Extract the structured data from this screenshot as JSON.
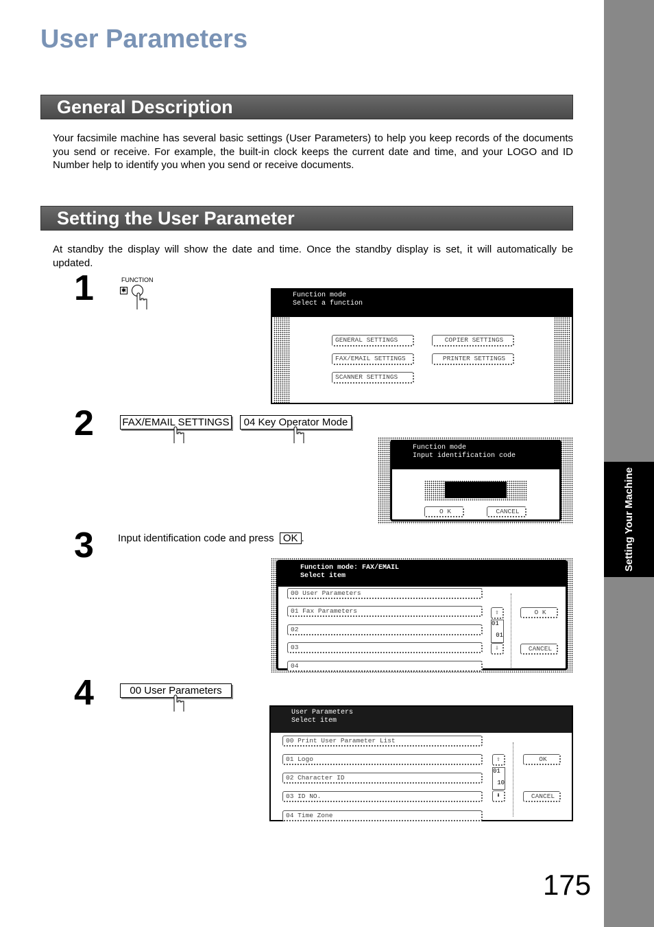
{
  "title": "User Parameters",
  "sections": [
    {
      "heading": "General Description",
      "text": "Your facsimile machine has several basic settings (User Parameters) to help you keep records of the documents you send or receive. For example, the built-in clock keeps the current date and time, and your LOGO and ID Number help to identify you when you send or receive documents."
    },
    {
      "heading": "Setting the User Parameter",
      "text": "At standby the display will show the date and time. Once the standby display is set, it will automatically be updated."
    }
  ],
  "sidebar_tab": "Setting Your Machine",
  "page_number": "175",
  "steps": [
    {
      "number": "1",
      "key_label": "FUNCTION",
      "key_symbol": "✱",
      "screen": {
        "line1": "Function mode",
        "line2": "Select a function",
        "buttons": [
          "GENERAL SETTINGS",
          "COPIER SETTINGS",
          "FAX/EMAIL SETTINGS",
          "PRINTER SETTINGS",
          "SCANNER SETTINGS"
        ]
      }
    },
    {
      "number": "2",
      "buttons": [
        "FAX/EMAIL SETTINGS",
        "04 Key Operator Mode"
      ],
      "screen": {
        "line1": "Function mode",
        "line2": "Input identification code",
        "ok": "O K",
        "cancel": "CANCEL"
      }
    },
    {
      "number": "3",
      "text": "Input identification code and press",
      "ok": "OK",
      "suffix": ".",
      "screen": {
        "line1": "Function mode: FAX/EMAIL",
        "line2": "Select item",
        "items": [
          "00  User Parameters",
          "01  Fax Parameters",
          "02",
          "03",
          "04"
        ],
        "page_top": "01",
        "page_bottom": "01",
        "ok": "O K",
        "cancel": "CANCEL"
      }
    },
    {
      "number": "4",
      "button": "00 User Parameters",
      "screen": {
        "line1": "User Parameters",
        "line2": "Select item",
        "items": [
          "00  Print User Parameter List",
          "01  Logo",
          "02  Character ID",
          "03  ID NO.",
          "04  Time Zone"
        ],
        "page_top": "01",
        "page_bottom": "10",
        "ok": "OK",
        "cancel": "CANCEL"
      }
    }
  ]
}
